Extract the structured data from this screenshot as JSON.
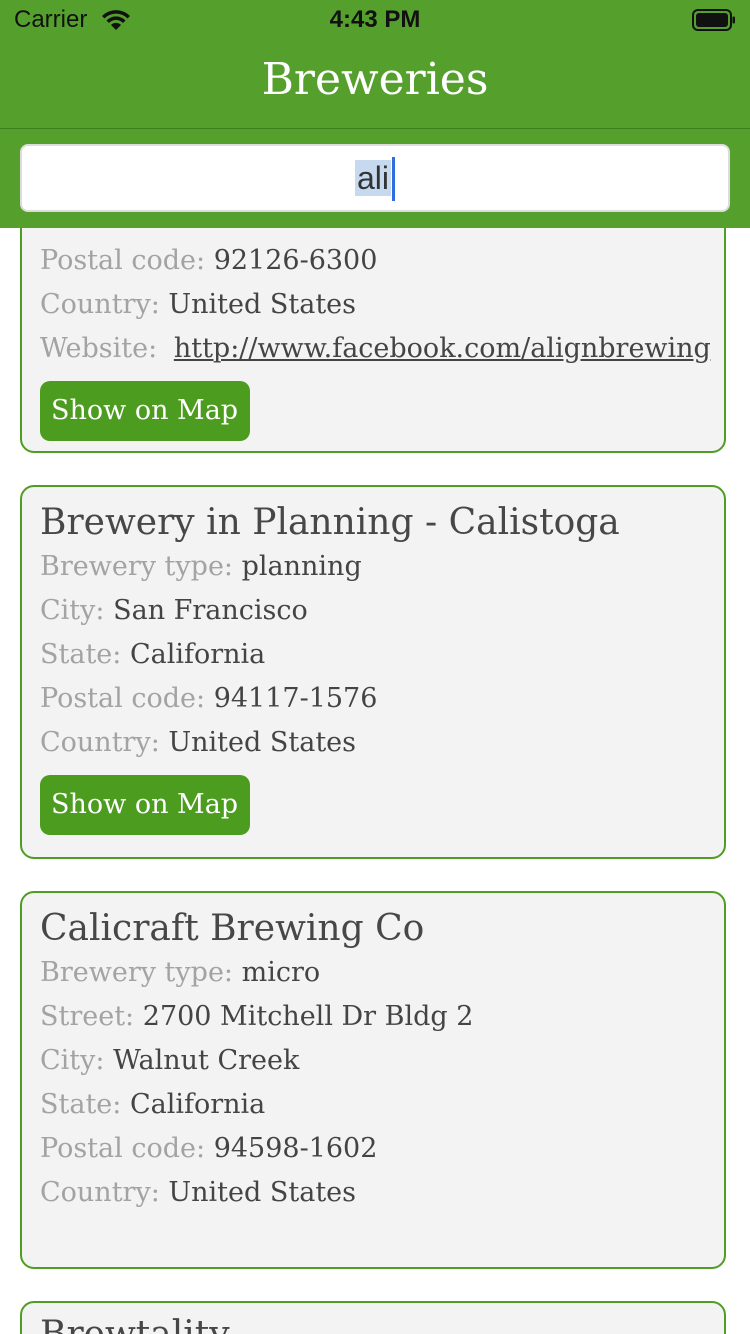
{
  "status_bar": {
    "carrier": "Carrier",
    "time": "4:43 PM",
    "wifi_icon": "wifi-icon",
    "battery_icon": "battery-icon"
  },
  "nav": {
    "title": "Breweries"
  },
  "search": {
    "value": "ali",
    "selected_text": "ali"
  },
  "accent_color": "#55a02d",
  "button_color": "#4c9d1f",
  "cards": [
    {
      "postal_code_label": "Postal code:",
      "postal_code": "92126-6300",
      "country_label": "Country:",
      "country": "United States",
      "website_label": "Website:",
      "website": "http://www.facebook.com/alignbrewing",
      "map_button": "Show on Map"
    },
    {
      "title": "Brewery in Planning - Calistoga",
      "type_label": "Brewery type:",
      "type": "planning",
      "city_label": "City:",
      "city": "San Francisco",
      "state_label": "State:",
      "state": "California",
      "postal_code_label": "Postal code:",
      "postal_code": "94117-1576",
      "country_label": "Country:",
      "country": "United States",
      "map_button": "Show on Map"
    },
    {
      "title": "Calicraft Brewing Co",
      "type_label": "Brewery type:",
      "type": "micro",
      "street_label": "Street:",
      "street": "2700 Mitchell Dr Bldg 2",
      "city_label": "City:",
      "city": "Walnut Creek",
      "state_label": "State:",
      "state": "California",
      "postal_code_label": "Postal code:",
      "postal_code": "94598-1602",
      "country_label": "Country:",
      "country": "United States"
    },
    {
      "title": "Brewtality"
    }
  ]
}
